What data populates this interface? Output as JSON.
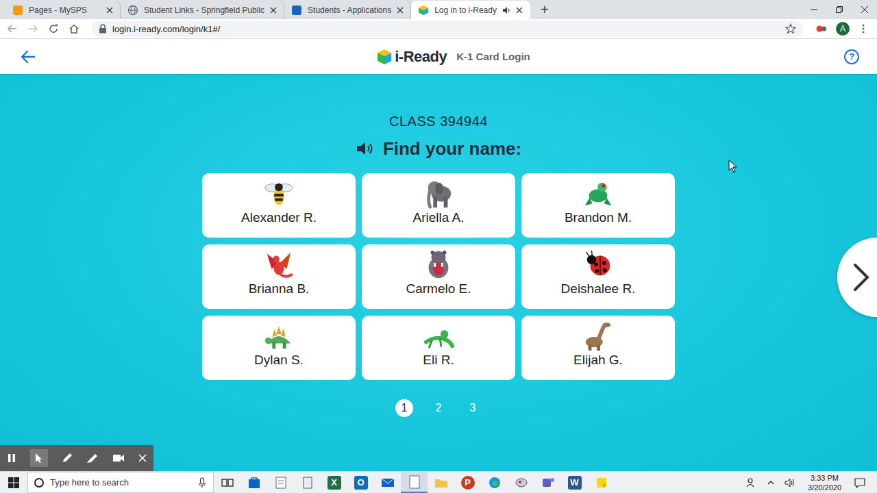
{
  "browser": {
    "tabs": [
      {
        "label": "Pages - MySPS",
        "selected": false,
        "playing_audio": false
      },
      {
        "label": "Student Links - Springfield Public",
        "selected": false,
        "playing_audio": false
      },
      {
        "label": "Students - Applications",
        "selected": false,
        "playing_audio": false
      },
      {
        "label": "Log in to i-Ready",
        "selected": true,
        "playing_audio": true
      }
    ],
    "new_tab": "+",
    "address": "login.i-ready.com/login/k1#/",
    "profile": "A"
  },
  "header": {
    "logo": "i-Ready",
    "title": "K-1 Card Login",
    "help": "?"
  },
  "class_label": "CLASS 394944",
  "prompt": "Find your name:",
  "students": [
    {
      "name": "Alexander R."
    },
    {
      "name": "Ariella A."
    },
    {
      "name": "Brandon M."
    },
    {
      "name": "Brianna B."
    },
    {
      "name": "Carmelo E."
    },
    {
      "name": "Deishalee R."
    },
    {
      "name": "Dylan S."
    },
    {
      "name": "Eli R."
    },
    {
      "name": "Elijah G."
    }
  ],
  "pages": [
    {
      "label": "1",
      "selected": true
    },
    {
      "label": "2",
      "selected": false
    },
    {
      "label": "3",
      "selected": false
    }
  ],
  "taskbar": {
    "search_placeholder": "Type here to search",
    "time": "3:33 PM",
    "date": "3/20/2020",
    "office_apps": [
      {
        "glyph": "X",
        "color": "#1e7145"
      },
      {
        "glyph": "O",
        "color": "#0f6cbd"
      },
      {
        "glyph": "P",
        "color": "#c43e1c"
      },
      {
        "glyph": "W",
        "color": "#2b579a"
      }
    ]
  }
}
